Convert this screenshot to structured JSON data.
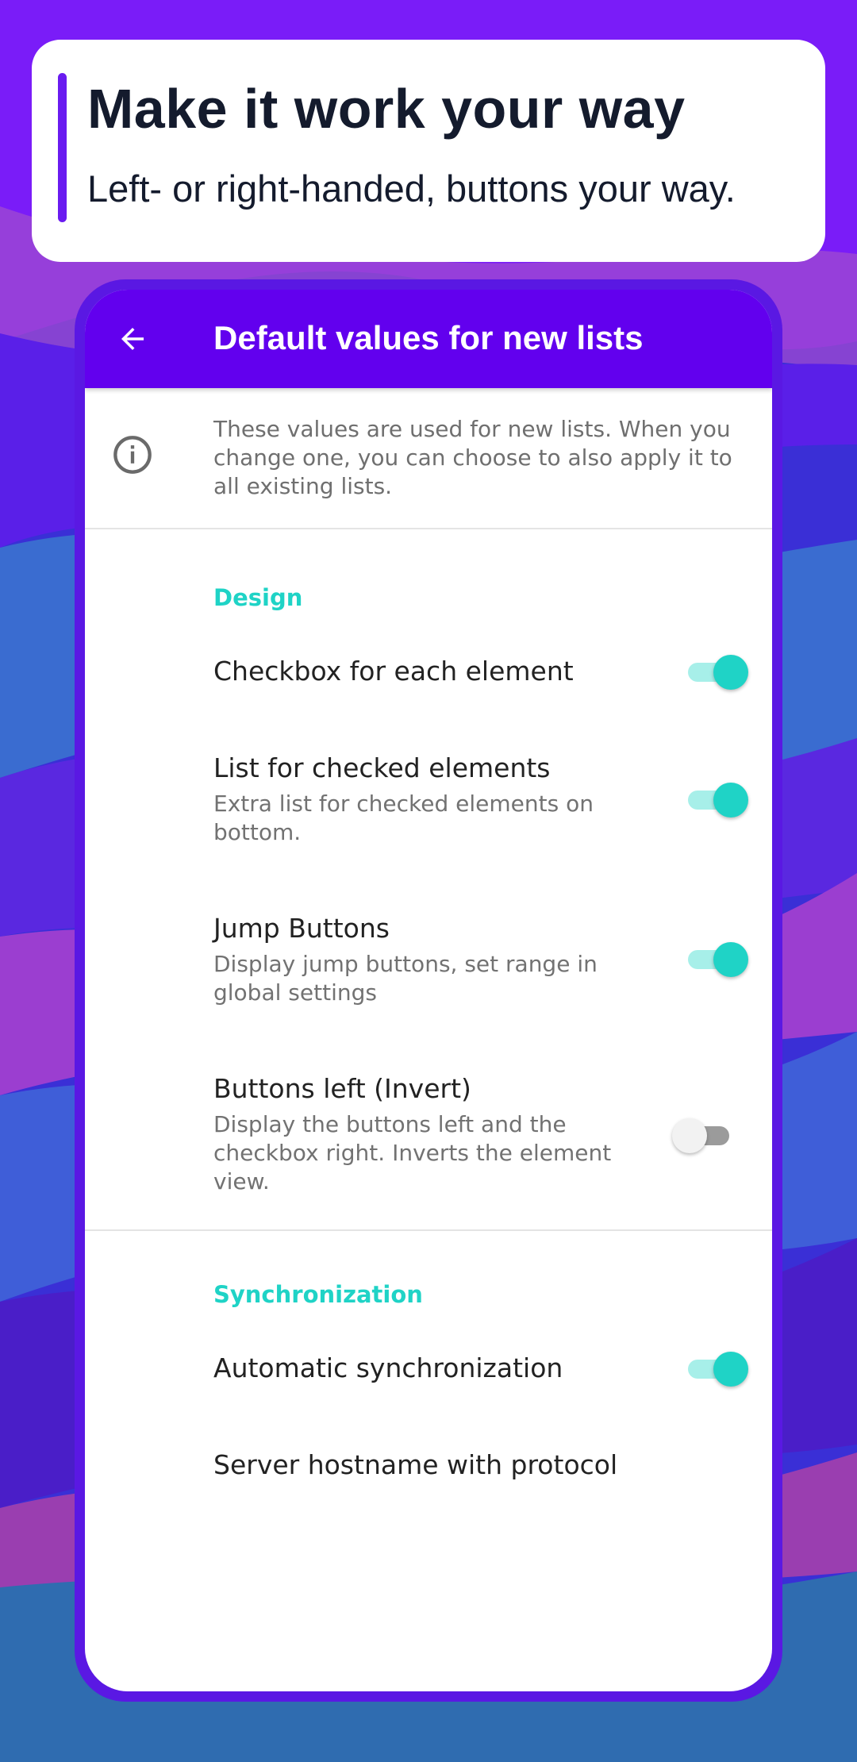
{
  "promo": {
    "title": "Make it work your way",
    "subtitle": "Left- or right-handed, buttons your way."
  },
  "appbar": {
    "back_icon": "arrow-left-icon",
    "title": "Default values for new lists"
  },
  "info": {
    "icon": "info-icon",
    "text": "These values are used for new lists. When you change one, you can choose to also apply it to all existing lists."
  },
  "sections": {
    "design": "Design",
    "sync": "Synchronization"
  },
  "prefs": {
    "checkbox": {
      "title": "Checkbox for each element",
      "enabled": true
    },
    "checked_list": {
      "title": "List for checked elements",
      "summary": "Extra list for checked elements on bottom.",
      "enabled": true
    },
    "jump": {
      "title": "Jump Buttons",
      "summary": "Display jump buttons, set range in global settings",
      "enabled": true
    },
    "buttons_left": {
      "title": "Buttons left (Invert)",
      "summary": "Display the buttons left and the checkbox right. Inverts the element view.",
      "enabled": false
    },
    "auto_sync": {
      "title": "Automatic synchronization",
      "enabled": true
    },
    "server": {
      "title": "Server hostname with protocol"
    }
  },
  "colors": {
    "appbar": "#6200ee",
    "accent": "#1fd3c6",
    "phone_frame": "#5a18e3"
  }
}
